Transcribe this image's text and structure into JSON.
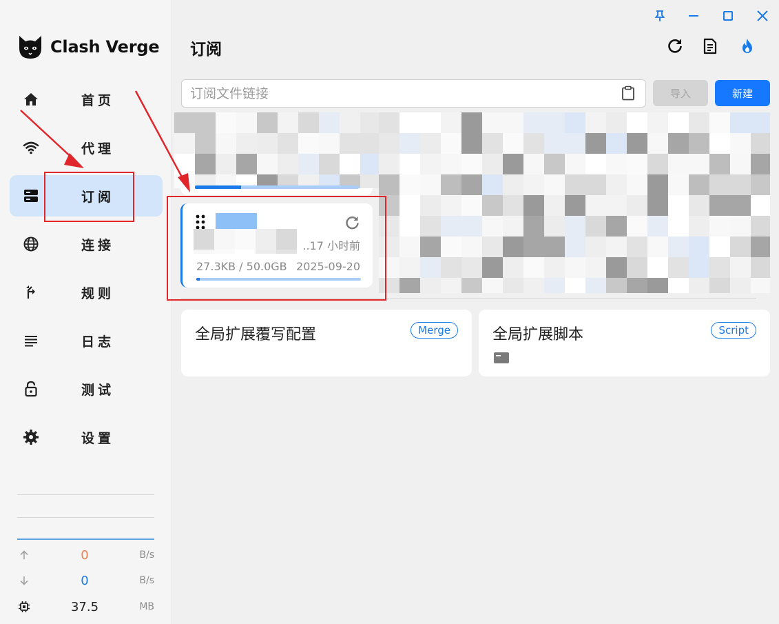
{
  "app": {
    "name": "Clash Verge"
  },
  "sidebar": {
    "items": [
      {
        "label": "首页",
        "icon": "home-icon"
      },
      {
        "label": "代理",
        "icon": "wifi-icon"
      },
      {
        "label": "订阅",
        "icon": "server-icon",
        "active": true
      },
      {
        "label": "连接",
        "icon": "globe-icon"
      },
      {
        "label": "规则",
        "icon": "route-icon"
      },
      {
        "label": "日志",
        "icon": "lines-icon"
      },
      {
        "label": "测试",
        "icon": "lock-open-icon"
      },
      {
        "label": "设置",
        "icon": "gear-icon"
      }
    ],
    "traffic": {
      "upload_value": "0",
      "upload_unit": "B/s",
      "download_value": "0",
      "download_unit": "B/s",
      "memory_value": "37.5",
      "memory_unit": "MB"
    }
  },
  "header": {
    "title": "订阅"
  },
  "toolbar": {
    "url_placeholder": "订阅文件链接",
    "import_label": "导入",
    "new_label": "新建"
  },
  "profile": {
    "updated": "..17 小时前",
    "usage": "27.3KB / 50.0GB",
    "expire": "2025-09-20",
    "usage_fraction": 0.02
  },
  "extensions": {
    "merge_title": "全局扩展覆写配置",
    "merge_badge": "Merge",
    "script_title": "全局扩展脚本",
    "script_badge": "Script"
  },
  "colors": {
    "accent": "#1677ff",
    "active_bg": "#d3e5fb",
    "upload": "#f0814f",
    "download": "#1a7ae8",
    "annotation": "#e0262a"
  }
}
